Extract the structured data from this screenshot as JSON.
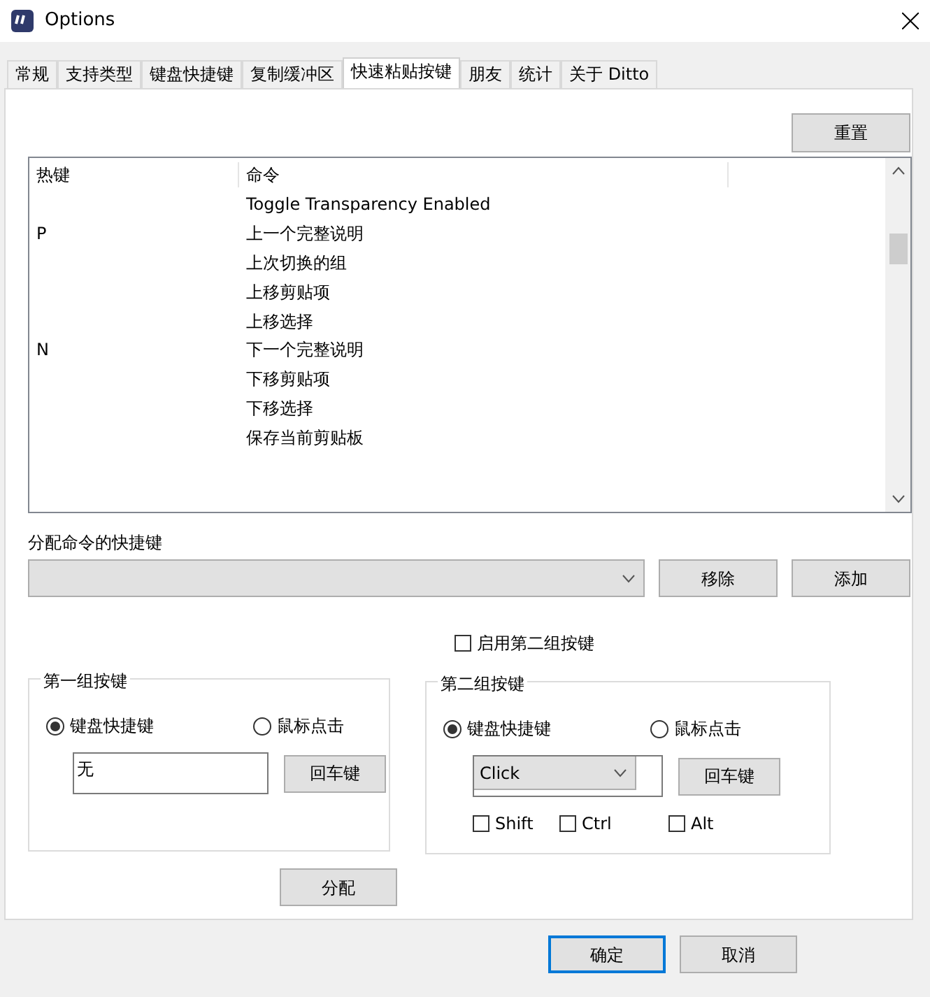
{
  "window": {
    "title": "Options"
  },
  "tabs": [
    {
      "label": "常规",
      "selected": false
    },
    {
      "label": "支持类型",
      "selected": false
    },
    {
      "label": "键盘快捷键",
      "selected": false
    },
    {
      "label": "复制缓冲区",
      "selected": false
    },
    {
      "label": "快速粘贴按键",
      "selected": true
    },
    {
      "label": "朋友",
      "selected": false
    },
    {
      "label": "统计",
      "selected": false
    },
    {
      "label": "关于 Ditto",
      "selected": false
    }
  ],
  "reset_button": "重置",
  "table": {
    "columns": [
      "热键",
      "命令"
    ],
    "rows": [
      {
        "hotkey": "",
        "command": "Toggle Transparency Enabled"
      },
      {
        "hotkey": "P",
        "command": "上一个完整说明"
      },
      {
        "hotkey": "",
        "command": "上次切换的组"
      },
      {
        "hotkey": "",
        "command": "上移剪贴项"
      },
      {
        "hotkey": "",
        "command": "上移选择"
      },
      {
        "hotkey": "N",
        "command": "下一个完整说明"
      },
      {
        "hotkey": "",
        "command": "下移剪贴项"
      },
      {
        "hotkey": "",
        "command": "下移选择"
      },
      {
        "hotkey": "",
        "command": "保存当前剪贴板"
      }
    ]
  },
  "command_label": "分配命令的快捷键",
  "remove_button": "移除",
  "add_button": "添加",
  "enable_second": {
    "label": "启用第二组按键",
    "checked": false
  },
  "groups": [
    {
      "title": "第一组按键",
      "radios": [
        {
          "label": "键盘快捷键",
          "selected": true
        },
        {
          "label": "鼠标点击",
          "selected": false
        }
      ],
      "kind": "text",
      "value": "无",
      "enter_button": "回车键"
    },
    {
      "title": "第二组按键",
      "radios": [
        {
          "label": "键盘快捷键",
          "selected": true
        },
        {
          "label": "鼠标点击",
          "selected": false
        }
      ],
      "kind": "select",
      "value": "Click",
      "enter_button": "回车键",
      "modifiers": [
        {
          "label": "Shift",
          "checked": false
        },
        {
          "label": "Ctrl",
          "checked": false
        },
        {
          "label": "Alt",
          "checked": false
        }
      ]
    }
  ],
  "assign_button": "分配",
  "ok_button": "确定",
  "cancel_button": "取消"
}
